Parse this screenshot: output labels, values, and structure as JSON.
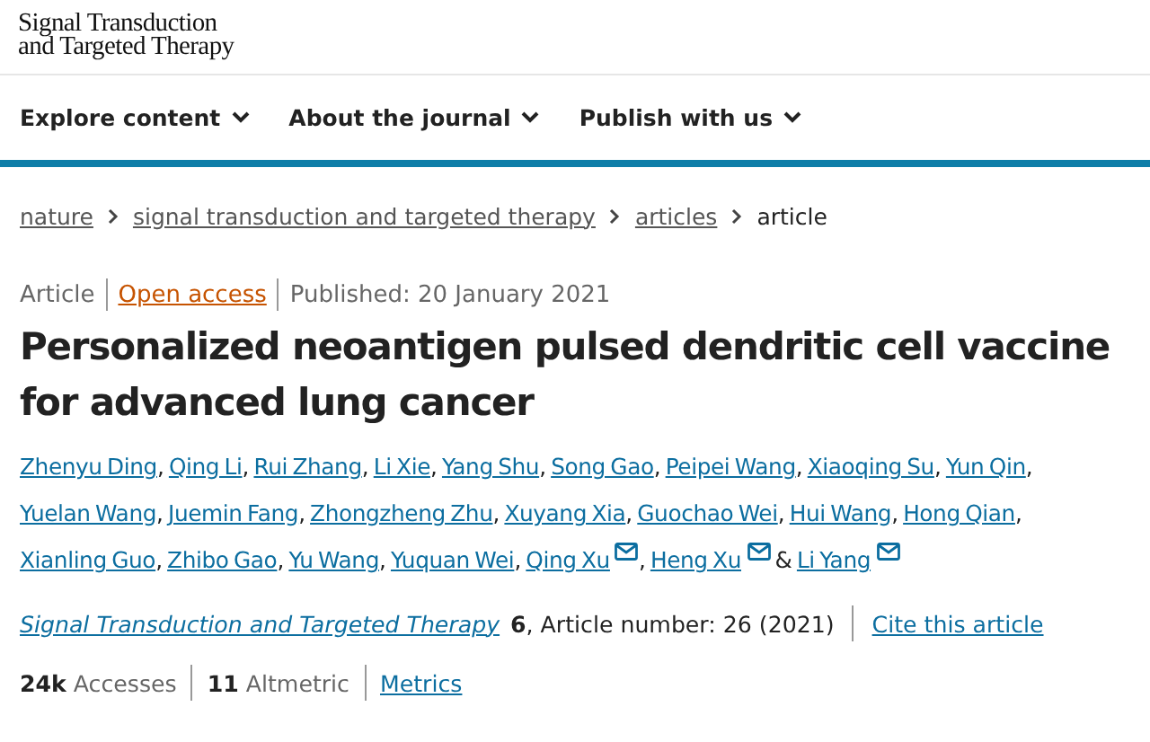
{
  "journal_logo": {
    "line_1": "Signal Transduction",
    "line_2": "and Targeted Therapy"
  },
  "nav": [
    {
      "label": "Explore content"
    },
    {
      "label": "About the journal"
    },
    {
      "label": "Publish with us"
    }
  ],
  "breadcrumbs": [
    {
      "label": "nature",
      "link": true
    },
    {
      "label": "signal transduction and targeted therapy",
      "link": true
    },
    {
      "label": "articles",
      "link": true
    },
    {
      "label": "article",
      "link": false
    }
  ],
  "article": {
    "type": "Article",
    "access": "Open access",
    "published": "Published: 20 January 2021",
    "title": "Personalized neoantigen pulsed dendritic cell vaccine for advanced lung cancer",
    "authors": [
      {
        "name": "Zhenyu Ding",
        "email": false,
        "after": ","
      },
      {
        "name": "Qing Li",
        "email": false,
        "after": ","
      },
      {
        "name": "Rui Zhang",
        "email": false,
        "after": ","
      },
      {
        "name": "Li Xie",
        "email": false,
        "after": ","
      },
      {
        "name": "Yang Shu",
        "email": false,
        "after": ","
      },
      {
        "name": "Song Gao",
        "email": false,
        "after": ","
      },
      {
        "name": "Peipei Wang",
        "email": false,
        "after": ","
      },
      {
        "name": "Xiaoqing Su",
        "email": false,
        "after": ","
      },
      {
        "name": "Yun Qin",
        "email": false,
        "after": ","
      },
      {
        "name": "Yuelan Wang",
        "email": false,
        "after": ","
      },
      {
        "name": "Juemin Fang",
        "email": false,
        "after": ","
      },
      {
        "name": "Zhongzheng Zhu",
        "email": false,
        "after": ","
      },
      {
        "name": "Xuyang Xia",
        "email": false,
        "after": ","
      },
      {
        "name": "Guochao Wei",
        "email": false,
        "after": ","
      },
      {
        "name": "Hui Wang",
        "email": false,
        "after": ","
      },
      {
        "name": "Hong Qian",
        "email": false,
        "after": ","
      },
      {
        "name": "Xianling Guo",
        "email": false,
        "after": ","
      },
      {
        "name": "Zhibo Gao",
        "email": false,
        "after": ","
      },
      {
        "name": "Yu Wang",
        "email": false,
        "after": ","
      },
      {
        "name": "Yuquan Wei",
        "email": false,
        "after": ","
      },
      {
        "name": "Qing Xu",
        "email": true,
        "after": ","
      },
      {
        "name": "Heng Xu",
        "email": true,
        "after": "&"
      },
      {
        "name": "Li Yang",
        "email": true
      }
    ],
    "journal": "Signal Transduction and Targeted Therapy",
    "citation": "**6**, Article number: 26 (2021)",
    "cite_link": "Cite this article",
    "metrics": [
      {
        "text": "**24k** Accesses"
      },
      {
        "text": "**11** Altmetric"
      }
    ],
    "metrics_link": "Metrics"
  }
}
